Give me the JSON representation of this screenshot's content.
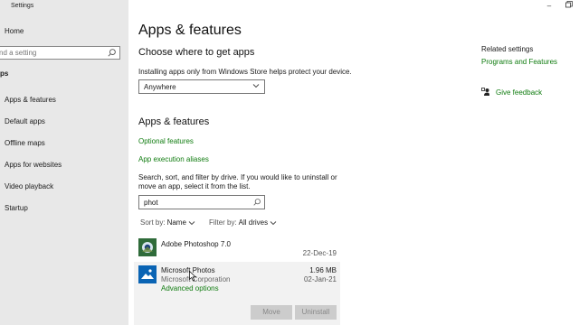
{
  "window": {
    "title": "Settings"
  },
  "sidebar": {
    "home_label": "Home",
    "search_placeholder": "nd a setting",
    "section_label": "ps",
    "items": [
      {
        "label": "Apps & features"
      },
      {
        "label": "Default apps"
      },
      {
        "label": "Offline maps"
      },
      {
        "label": "Apps for websites"
      },
      {
        "label": "Video playback"
      },
      {
        "label": "Startup"
      }
    ]
  },
  "main": {
    "page_title": "Apps & features",
    "choose": {
      "heading": "Choose where to get apps",
      "description": "Installing apps only from Windows Store helps protect your device.",
      "dropdown_value": "Anywhere"
    },
    "apps": {
      "heading": "Apps & features",
      "optional_features": "Optional features",
      "execution_aliases": "App execution aliases",
      "search_help_line1": "Search, sort, and filter by drive. If you would like to uninstall or",
      "search_help_line2": "move an app, select it from the list.",
      "search_value": "phot",
      "sort_label": "Sort by:",
      "sort_value": "Name",
      "filter_label": "Filter by:",
      "filter_value": "All drives",
      "list": [
        {
          "name": "Adobe Photoshop 7.0",
          "publisher": "",
          "size": "",
          "date": "22-Dec-19",
          "icon": "photoshop-icon"
        },
        {
          "name": "Microsoft Photos",
          "publisher": "Microsoft Corporation",
          "size": "1.96 MB",
          "date": "02-Jan-21",
          "icon": "photos-icon",
          "advanced": "Advanced options",
          "selected": true
        }
      ],
      "move_label": "Move",
      "uninstall_label": "Uninstall"
    }
  },
  "related": {
    "heading": "Related settings",
    "programs_link": "Programs and Features",
    "feedback_link": "Give feedback"
  },
  "colors": {
    "accent_link": "#107c10",
    "sidebar_bg": "#e8e8e8",
    "selected_row_bg": "#f2f2f2"
  }
}
